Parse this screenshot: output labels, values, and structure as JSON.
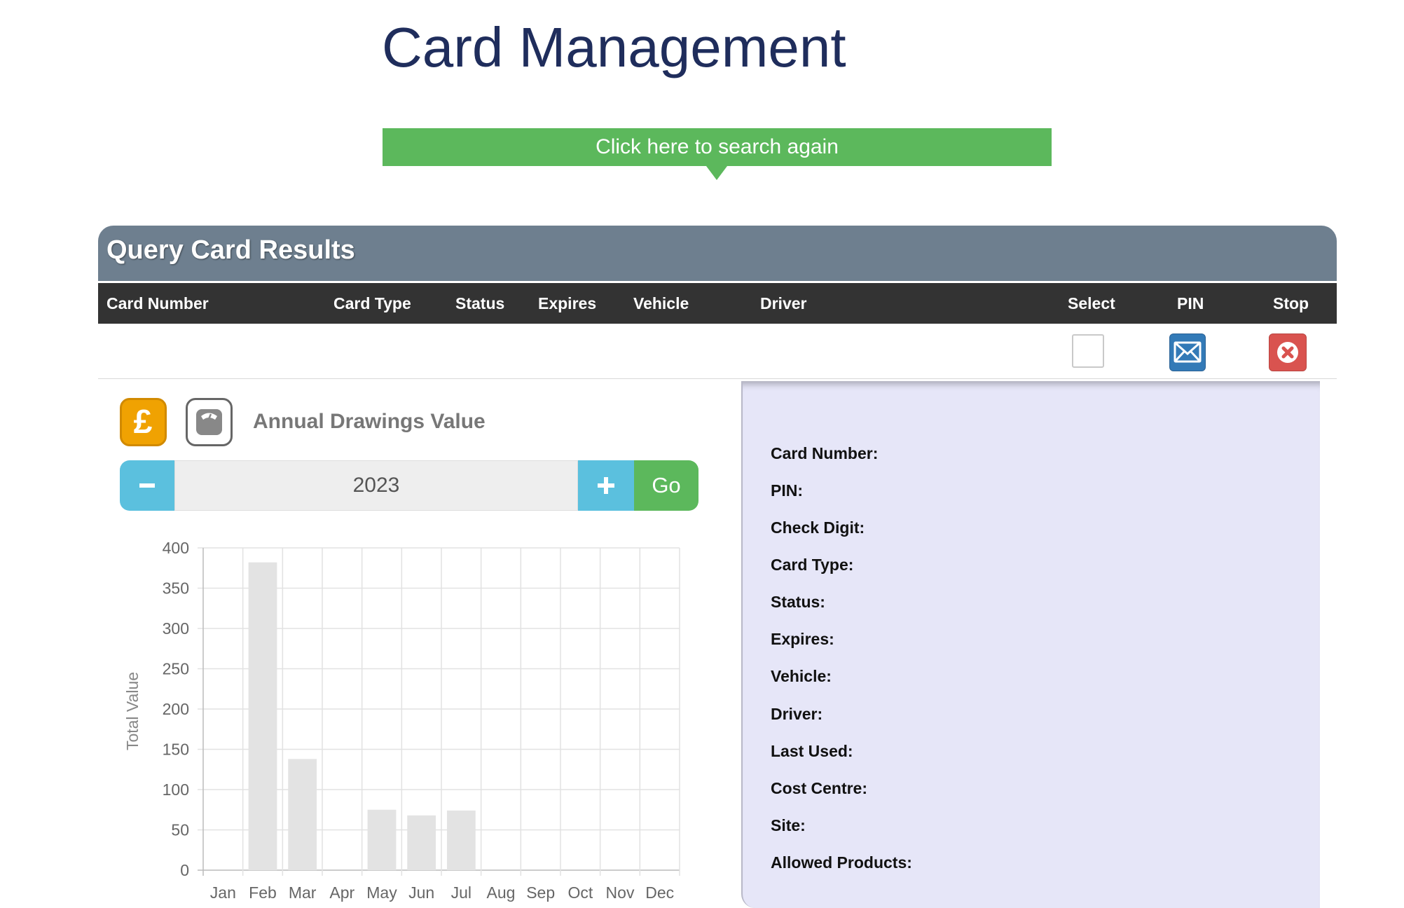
{
  "page": {
    "title": "Card Management"
  },
  "search_again": {
    "label": "Click here to search again"
  },
  "results": {
    "title": "Query Card Results",
    "columns": [
      "Card Number",
      "Card Type",
      "Status",
      "Expires",
      "Vehicle",
      "Driver",
      "Select",
      "PIN",
      "Stop"
    ],
    "row_actions": {
      "select_checked": false,
      "pin_icon": "envelope-icon",
      "stop_icon": "x-circle-icon"
    }
  },
  "drawings": {
    "title": "Annual Drawings Value",
    "value_icon": "pound-icon",
    "volume_icon": "scale-icon",
    "year": "2023",
    "minus_label": "−",
    "plus_label": "+",
    "go_label": "Go"
  },
  "colors": {
    "title": "#1f2d5c",
    "search_button": "#5cb85c",
    "results_header": "#6e7f8f",
    "table_header": "#333333",
    "pin_button": "#337ab7",
    "stop_button": "#d9534f",
    "pound_button": "#f0a202",
    "stepper": "#5bc0de",
    "go_button": "#5cb85c",
    "detail_panel": "#e6e6f8",
    "bars": "#e3e3e3"
  },
  "chart_data": {
    "type": "bar",
    "categories": [
      "Jan",
      "Feb",
      "Mar",
      "Apr",
      "May",
      "Jun",
      "Jul",
      "Aug",
      "Sep",
      "Oct",
      "Nov",
      "Dec"
    ],
    "values": [
      0,
      382,
      138,
      0,
      75,
      68,
      74,
      0,
      0,
      0,
      0,
      0
    ],
    "ylabel": "Total Value",
    "xlabel": "",
    "ylim": [
      0,
      400
    ],
    "yticks": [
      0,
      50,
      100,
      150,
      200,
      250,
      300,
      350,
      400
    ],
    "grid": true,
    "legend": "none"
  },
  "details": {
    "labels": [
      "Card Number:",
      "PIN:",
      "Check Digit:",
      "Card Type:",
      "Status:",
      "Expires:",
      "Vehicle:",
      "Driver:",
      "Last Used:",
      "Cost Centre:",
      "Site:",
      "Allowed Products:"
    ]
  }
}
